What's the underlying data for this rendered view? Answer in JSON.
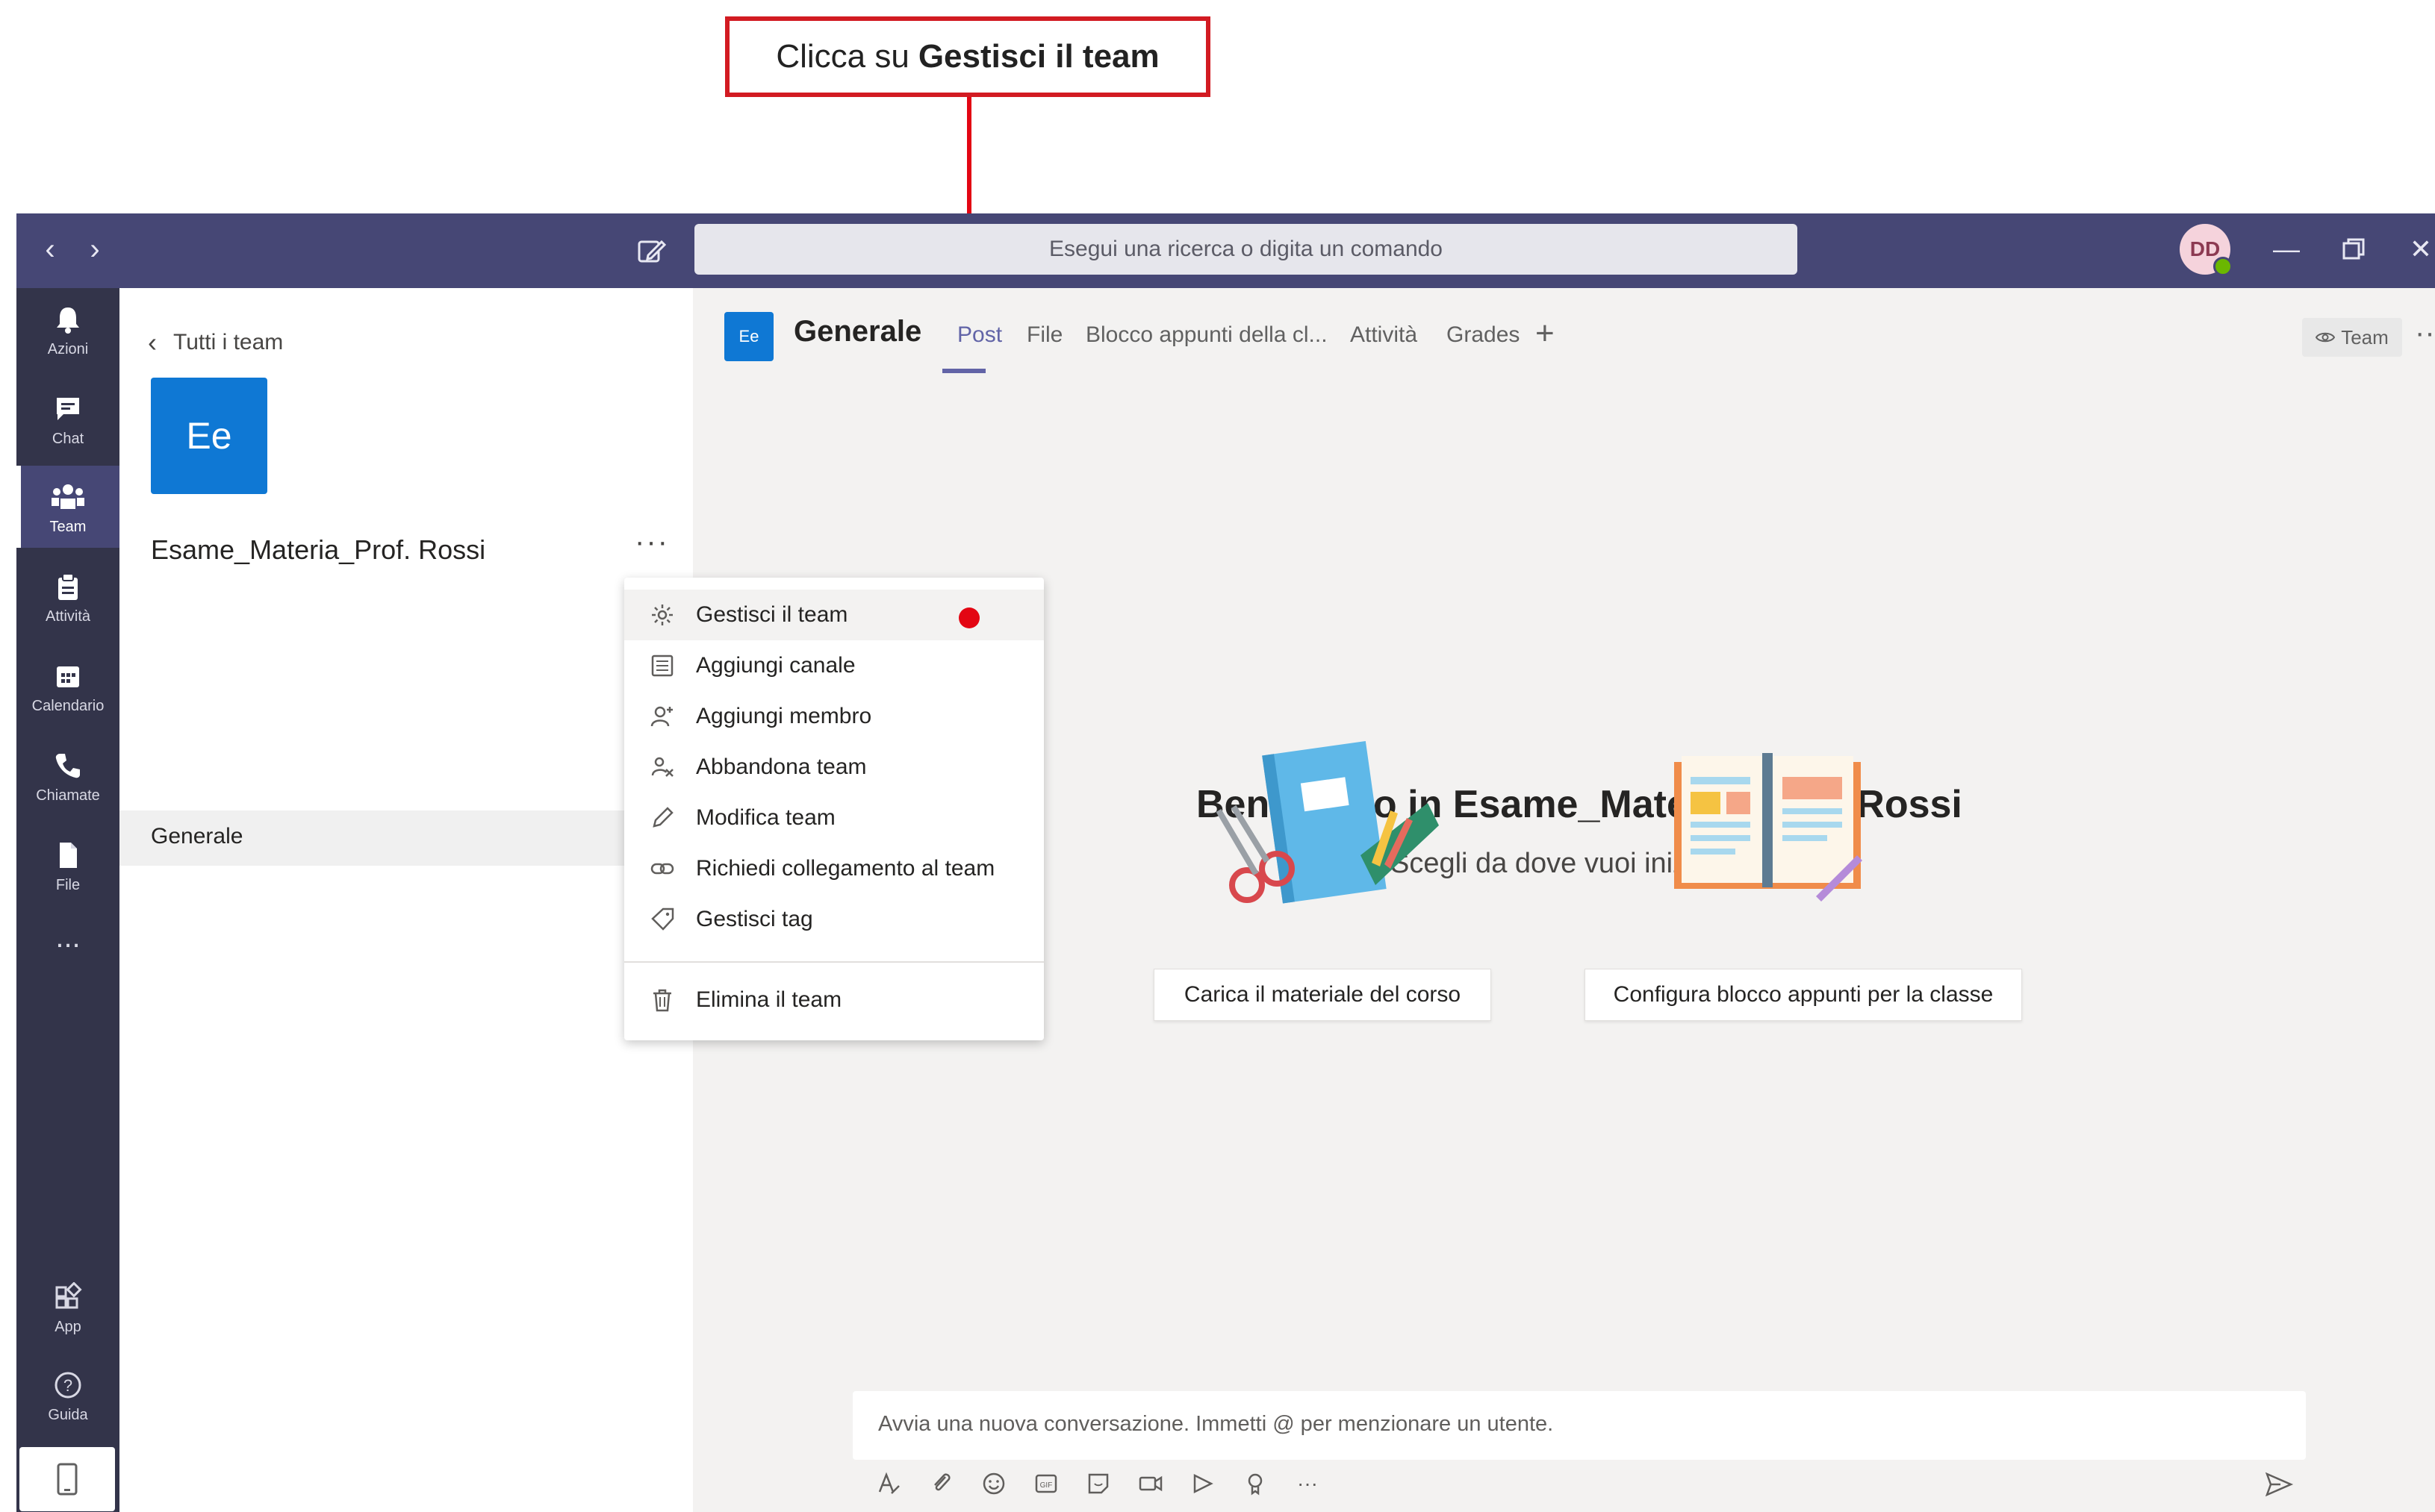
{
  "callout": {
    "prefix": "Clicca su",
    "bold": "Gestisci il team"
  },
  "titlebar": {
    "search_placeholder": "Esegui una ricerca o digita un comando",
    "avatar_initials": "DD"
  },
  "rail": {
    "items": [
      {
        "label": "Azioni",
        "icon": "bell-icon"
      },
      {
        "label": "Chat",
        "icon": "chat-icon"
      },
      {
        "label": "Team",
        "icon": "teams-icon",
        "active": true
      },
      {
        "label": "Attività",
        "icon": "assignments-icon"
      },
      {
        "label": "Calendario",
        "icon": "calendar-icon"
      },
      {
        "label": "Chiamate",
        "icon": "phone-icon"
      },
      {
        "label": "File",
        "icon": "file-icon"
      }
    ],
    "more": "...",
    "bottom": [
      {
        "label": "App",
        "icon": "apps-icon"
      },
      {
        "label": "Guida",
        "icon": "help-icon"
      }
    ]
  },
  "panel": {
    "back_label": "Tutti i team",
    "team_initials": "Ee",
    "team_name": "Esame_Materia_Prof. Rossi",
    "more": "···",
    "channel": "Generale"
  },
  "header": {
    "channel_initials": "Ee",
    "channel_title": "Generale",
    "tabs": [
      "Post",
      "File",
      "Blocco appunti della cl...",
      "Attività",
      "Grades"
    ],
    "add_tab": "+",
    "team_button": "Team",
    "more": "···"
  },
  "welcome": {
    "title": "Benvenuto in Esame_Materia_Prof. Rossi",
    "subtitle": "Scegli da dove vuoi iniziare",
    "button_left": "Carica il materiale del corso",
    "button_right": "Configura blocco appunti per la classe"
  },
  "menu": {
    "items": [
      {
        "label": "Gestisci il team",
        "icon": "gear-icon"
      },
      {
        "label": "Aggiungi canale",
        "icon": "channel-icon"
      },
      {
        "label": "Aggiungi membro",
        "icon": "add-member-icon"
      },
      {
        "label": "Abbandona team",
        "icon": "leave-icon"
      },
      {
        "label": "Modifica team",
        "icon": "pencil-icon"
      },
      {
        "label": "Richiedi collegamento al team",
        "icon": "link-icon"
      },
      {
        "label": "Gestisci tag",
        "icon": "tag-icon"
      }
    ],
    "delete": {
      "label": "Elimina il team",
      "icon": "trash-icon"
    }
  },
  "compose": {
    "placeholder": "Avvia una nuova conversazione. Immetti @ per menzionare un utente.",
    "tools_more": "···"
  },
  "colors": {
    "titlebar": "#464775",
    "rail": "#33344a",
    "accent": "#6264a7",
    "team_tile": "#0f78d4",
    "annotation": "#e30613"
  }
}
